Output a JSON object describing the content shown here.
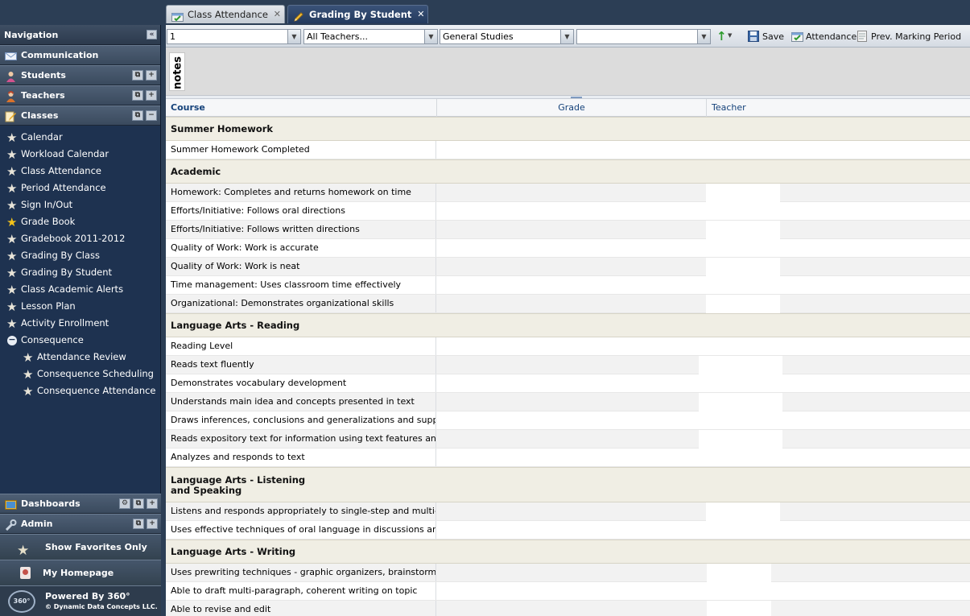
{
  "tabs": [
    {
      "label": "Class Attendance",
      "icon": "attendance-icon",
      "active": false
    },
    {
      "label": "Grading By Student",
      "icon": "pencil-icon",
      "active": true
    }
  ],
  "sidebar": {
    "title": "Navigation",
    "sections_top": [
      {
        "label": "Communication",
        "icon": "envelope-icon"
      },
      {
        "label": "Students",
        "icon": "student-icon"
      },
      {
        "label": "Teachers",
        "icon": "teacher-icon"
      },
      {
        "label": "Classes",
        "icon": "classes-icon"
      }
    ],
    "items": [
      {
        "label": "Calendar",
        "icon": "star-icon"
      },
      {
        "label": "Workload Calendar",
        "icon": "star-icon"
      },
      {
        "label": "Class Attendance",
        "icon": "star-icon"
      },
      {
        "label": "Period Attendance",
        "icon": "star-icon"
      },
      {
        "label": "Sign In/Out",
        "icon": "star-icon"
      },
      {
        "label": "Grade Book",
        "icon": "star-icon",
        "favorite": true
      },
      {
        "label": "Gradebook 2011-2012",
        "icon": "star-icon"
      },
      {
        "label": "Grading By Class",
        "icon": "star-icon"
      },
      {
        "label": "Grading By Student",
        "icon": "star-icon"
      },
      {
        "label": "Class Academic Alerts",
        "icon": "star-icon"
      },
      {
        "label": "Lesson Plan",
        "icon": "star-icon"
      },
      {
        "label": "Activity Enrollment",
        "icon": "star-icon"
      },
      {
        "label": "Consequence",
        "icon": "minus-circle-icon"
      },
      {
        "label": "Attendance Review",
        "icon": "star-icon",
        "sub": true
      },
      {
        "label": "Consequence Scheduling",
        "icon": "star-icon",
        "sub": true
      },
      {
        "label": "Consequence Attendance",
        "icon": "star-icon",
        "sub": true
      }
    ],
    "sections_bottom": [
      {
        "label": "Dashboards",
        "icon": "dashboard-icon"
      },
      {
        "label": "Admin",
        "icon": "wrench-icon"
      }
    ],
    "show_favorites": "Show Favorites Only",
    "my_homepage": "My Homepage",
    "powered_by": "Powered By 360°",
    "copyright": "© Dynamic Data Concepts LLC."
  },
  "toolbar": {
    "term_value": "1",
    "teacher_value": "All Teachers...",
    "subject_value": "General Studies",
    "extra_value": "",
    "save_label": "Save",
    "attendance_label": "Attendance",
    "prev_label": "Prev. Marking Period"
  },
  "notes_label": "notes",
  "grid": {
    "columns": {
      "course": "Course",
      "grade": "Grade",
      "teacher": "Teacher"
    },
    "groups": [
      {
        "title": "Summer Homework",
        "rows": [
          "Summer Homework Completed"
        ]
      },
      {
        "title": "Academic",
        "rows": [
          "Homework: Completes and returns homework on time",
          "Efforts/Initiative: Follows oral directions",
          "Efforts/Initiative: Follows written directions",
          "Quality of Work: Work is accurate",
          "Quality of Work: Work is neat",
          "Time management: Uses classroom time effectively",
          "Organizational: Demonstrates organizational skills"
        ]
      },
      {
        "title": "Language Arts - Reading",
        "rows": [
          "Reading Level",
          "Reads text fluently",
          "Demonstrates vocabulary development",
          "Understands main idea and concepts presented in text",
          "Draws inferences, conclusions and generalizations and supports w",
          "Reads expository text for information using text features and organi",
          "Analyzes and responds to text"
        ]
      },
      {
        "title": "Language Arts - Listening and Speaking",
        "rows": [
          "Listens and responds appropriately to single-step and multi-step inst",
          "Uses effective techniques of oral language in discussions and prese"
        ]
      },
      {
        "title": "Language Arts - Writing",
        "rows": [
          "Uses prewriting techniques - graphic organizers, brainstorming, and",
          "Able to draft multi-paragraph, coherent writing on topic",
          "Able to revise and edit"
        ]
      }
    ]
  }
}
